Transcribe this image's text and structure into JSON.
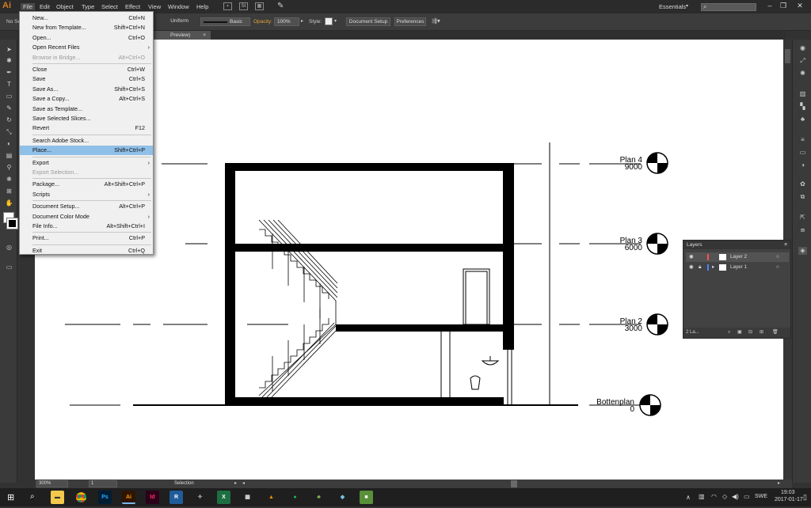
{
  "app": {
    "logo": "Ai"
  },
  "menubar": {
    "items": [
      "File",
      "Edit",
      "Object",
      "Type",
      "Select",
      "Effect",
      "View",
      "Window",
      "Help"
    ],
    "workspace": "Essentials"
  },
  "controlbar": {
    "no_selection": "No Se",
    "stroke_profile": "Uniform",
    "brush": "Basic",
    "opacity_label": "Opacity:",
    "opacity_value": "100%",
    "style_label": "Style:",
    "document_setup": "Document Setup",
    "preferences": "Preferences"
  },
  "document_tab": {
    "label": "Preview)"
  },
  "file_menu": [
    {
      "label": "New...",
      "shortcut": "Ctrl+N"
    },
    {
      "label": "New from Template...",
      "shortcut": "Shift+Ctrl+N"
    },
    {
      "label": "Open...",
      "shortcut": "Ctrl+O"
    },
    {
      "label": "Open Recent Files",
      "submenu": true
    },
    {
      "label": "Browse in Bridge...",
      "shortcut": "Alt+Ctrl+O",
      "disabled": true
    },
    {
      "sep": true
    },
    {
      "label": "Close",
      "shortcut": "Ctrl+W"
    },
    {
      "label": "Save",
      "shortcut": "Ctrl+S"
    },
    {
      "label": "Save As...",
      "shortcut": "Shift+Ctrl+S"
    },
    {
      "label": "Save a Copy...",
      "shortcut": "Alt+Ctrl+S"
    },
    {
      "label": "Save as Template..."
    },
    {
      "label": "Save Selected Slices..."
    },
    {
      "label": "Revert",
      "shortcut": "F12"
    },
    {
      "sep": true
    },
    {
      "label": "Search Adobe Stock..."
    },
    {
      "label": "Place...",
      "shortcut": "Shift+Ctrl+P",
      "highlighted": true
    },
    {
      "sep": true
    },
    {
      "label": "Export",
      "submenu": true
    },
    {
      "label": "Export Selection...",
      "disabled": true
    },
    {
      "sep": true
    },
    {
      "label": "Package...",
      "shortcut": "Alt+Shift+Ctrl+P"
    },
    {
      "label": "Scripts",
      "submenu": true
    },
    {
      "sep": true
    },
    {
      "label": "Document Setup...",
      "shortcut": "Alt+Ctrl+P"
    },
    {
      "label": "Document Color Mode",
      "submenu": true
    },
    {
      "label": "File Info...",
      "shortcut": "Alt+Shift+Ctrl+I"
    },
    {
      "sep": true
    },
    {
      "label": "Print...",
      "shortcut": "Ctrl+P"
    },
    {
      "sep": true
    },
    {
      "label": "Exit",
      "shortcut": "Ctrl+Q"
    }
  ],
  "drawing": {
    "levels": [
      {
        "name": "Plan 4",
        "value": "9000"
      },
      {
        "name": "Plan 3",
        "value": "6000"
      },
      {
        "name": "Plan 2",
        "value": "3000"
      },
      {
        "name": "Bottenplan",
        "value": "0"
      }
    ]
  },
  "layers_panel": {
    "title": "Layers",
    "layers": [
      {
        "name": "Layer 2",
        "color": "#ff4f4f",
        "selected": true
      },
      {
        "name": "Layer 1",
        "color": "#4f80ff",
        "selected": false
      }
    ],
    "count_label": "2 La..."
  },
  "statusbar": {
    "zoom": "300%",
    "artboard": "1",
    "tool": "Selection"
  },
  "taskbar": {
    "apps": [
      "file-explorer",
      "chrome",
      "photoshop",
      "illustrator",
      "indesign",
      "revit",
      "app7",
      "excel",
      "calculator",
      "vlc",
      "spotify",
      "app12",
      "app13",
      "minecraft"
    ],
    "app_labels": {
      "photoshop": "Ps",
      "illustrator": "Ai",
      "indesign": "Id",
      "revit": "R"
    },
    "language": "SWE",
    "time": "19:03",
    "date": "2017-01-17"
  }
}
